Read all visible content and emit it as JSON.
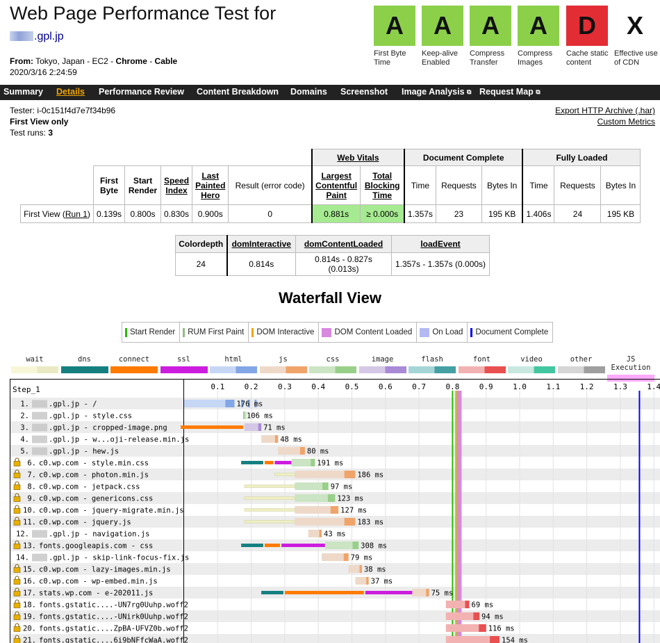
{
  "header": {
    "title": "Web Page Performance Test for",
    "site": ".gpl.jp",
    "from_label": "From:",
    "from_location": "Tokyo, Japan - EC2 -",
    "browser": "Chrome",
    "connectivity": "Cable",
    "date": "2020/3/16 2:24:59"
  },
  "grades": [
    {
      "grade": "A",
      "caption": "First Byte Time"
    },
    {
      "grade": "A",
      "caption": "Keep-alive Enabled"
    },
    {
      "grade": "A",
      "caption": "Compress Transfer"
    },
    {
      "grade": "A",
      "caption": "Compress Images"
    },
    {
      "grade": "D",
      "caption": "Cache static content"
    },
    {
      "grade": "X",
      "caption": "Effective use of CDN"
    }
  ],
  "nav": [
    "Summary",
    "Details",
    "Performance Review",
    "Content Breakdown",
    "Domains",
    "Screenshot",
    "Image Analysis",
    "Request Map"
  ],
  "nav_ext_icon": "external-link-icon",
  "test_info": {
    "tester": "Tester: i-0c151f4d7e7f34b96",
    "view": "First View only",
    "runs_label": "Test runs:",
    "runs": "3",
    "export_link": "Export HTTP Archive (.har)",
    "metrics_link": "Custom Metrics"
  },
  "results": {
    "group_web_vitals": "Web Vitals",
    "group_doc": "Document Complete",
    "group_full": "Fully Loaded",
    "h_first_byte": "First Byte",
    "h_start_render": "Start Render",
    "h_speed_index": "Speed Index",
    "h_last_painted": "Last Painted Hero",
    "h_result": "Result (error code)",
    "h_lcp": "Largest Contentful Paint",
    "h_tbt": "Total Blocking Time",
    "h_time": "Time",
    "h_requests": "Requests",
    "h_bytes": "Bytes In",
    "row_label": "First View (",
    "run_link": "Run 1",
    "row_label_end": ")",
    "first_byte": "0.139s",
    "start_render": "0.800s",
    "speed_index": "0.830s",
    "last_painted": "0.900s",
    "result": "0",
    "lcp": "0.881s",
    "tbt": "≥ 0.000s",
    "doc_time": "1.357s",
    "doc_requests": "23",
    "doc_bytes": "195 KB",
    "full_time": "1.406s",
    "full_requests": "24",
    "full_bytes": "195 KB"
  },
  "dom_table": {
    "h_colordepth": "Colordepth",
    "h_interactive": "domInteractive",
    "h_content_loaded": "domContentLoaded",
    "h_load_event": "loadEvent",
    "colordepth": "24",
    "interactive": "0.814s",
    "content_loaded": "0.814s - 0.827s (0.013s)",
    "load_event": "1.357s - 1.357s (0.000s)"
  },
  "waterfall": {
    "title": "Waterfall View",
    "markers": [
      {
        "label": "Start Render",
        "color": "#28bc00",
        "kind": "line"
      },
      {
        "label": "RUM First Paint",
        "color": "#8fbc83",
        "kind": "line"
      },
      {
        "label": "DOM Interactive",
        "color": "#f0a500",
        "kind": "line"
      },
      {
        "label": "DOM Content Loaded",
        "color": "#d888df",
        "kind": "box"
      },
      {
        "label": "On Load",
        "color": "#b3b9f2",
        "kind": "box"
      },
      {
        "label": "Document Complete",
        "color": "#0000ff",
        "kind": "line"
      }
    ],
    "types": [
      {
        "label": "wait",
        "a": "#f7f7d8",
        "b": "#e9e9c4"
      },
      {
        "label": "dns",
        "a": "#168080",
        "b": "#168080"
      },
      {
        "label": "connect",
        "a": "#ff7b00",
        "b": "#ff7b00"
      },
      {
        "label": "ssl",
        "a": "#cc1dde",
        "b": "#cc1dde"
      },
      {
        "label": "html",
        "a": "#c6d7f6",
        "b": "#82a6e6"
      },
      {
        "label": "js",
        "a": "#eed9c9",
        "b": "#f0a46a"
      },
      {
        "label": "css",
        "a": "#cbe4c4",
        "b": "#99d089"
      },
      {
        "label": "image",
        "a": "#d5c8e6",
        "b": "#a98ad6"
      },
      {
        "label": "flash",
        "a": "#a6d5d7",
        "b": "#44a0a3"
      },
      {
        "label": "font",
        "a": "#f3b2b2",
        "b": "#e95050"
      },
      {
        "label": "video",
        "a": "#c8e8df",
        "b": "#43c7a0"
      },
      {
        "label": "other",
        "a": "#d6d6d6",
        "b": "#9f9f9f"
      },
      {
        "label": "JS Execution",
        "a": "#ffaaff",
        "b": "#ffaaff"
      }
    ],
    "step_label": "Step_1",
    "ticks": [
      "0.1",
      "0.2",
      "0.3",
      "0.4",
      "0.5",
      "0.6",
      "0.7",
      "0.8",
      "0.9",
      "1.0",
      "1.1",
      "1.2",
      "1.3",
      "1.4"
    ],
    "lock_icon": "lock-icon",
    "requests": [
      {
        "n": "1.",
        "label": ".gpl.jp - /",
        "secure": false,
        "blur": true,
        "type": "html",
        "wait": 0.0,
        "dns": 0.0,
        "connect": 0.04,
        "ssl": 0.0,
        "start": 0.0,
        "ttfb": 0.08,
        "dl": 0.15,
        "ms": "176 ms"
      },
      {
        "n": "2.",
        "label": ".gpl.jp - style.css",
        "secure": false,
        "blur": true,
        "type": "css",
        "wait": 0.0,
        "dns": 0.0,
        "connect": 0.0,
        "ssl": 0.0,
        "start": 0.18,
        "ttfb": 0.0,
        "dl": 0.18,
        "ms": "106 ms"
      },
      {
        "n": "3.",
        "label": ".gpl.jp - cropped-image.png",
        "secure": false,
        "blur": true,
        "type": "image",
        "wait": 0.0,
        "dns": 0.0,
        "connect": 0.03,
        "ssl": 0.0,
        "start": 0.18,
        "ttfb": 0.0,
        "dl": 0.23,
        "ms": "71 ms"
      },
      {
        "n": "4.",
        "label": ".gpl.jp - w...oji-release.min.js",
        "secure": false,
        "blur": true,
        "type": "js",
        "wait": 0.0,
        "dns": 0.0,
        "connect": 0.0,
        "ssl": 0.0,
        "start": 0.23,
        "ttfb": 0.0,
        "dl": 0.28,
        "ms": "48 ms"
      },
      {
        "n": "5.",
        "label": ".gpl.jp - hew.js",
        "secure": false,
        "blur": true,
        "type": "js",
        "wait": 0.0,
        "dns": 0.0,
        "connect": 0.0,
        "ssl": 0.0,
        "start": 0.28,
        "ttfb": 0.0,
        "dl": 0.36,
        "ms": "80 ms"
      },
      {
        "n": "6.",
        "label": "c0.wp.com - style.min.css",
        "secure": true,
        "blur": false,
        "type": "css",
        "wait": 0.0,
        "dns": 0.17,
        "connect": 0.24,
        "ssl": 0.27,
        "start": 0.32,
        "ttfb": 0.0,
        "dl": 0.39,
        "ms": "191 ms"
      },
      {
        "n": "7.",
        "label": "c0.wp.com - photon.min.js",
        "secure": true,
        "blur": false,
        "type": "js",
        "wait": 0.27,
        "dns": 0.0,
        "connect": 0.0,
        "ssl": 0.0,
        "start": 0.33,
        "ttfb": 0.0,
        "dl": 0.51,
        "ms": "186 ms"
      },
      {
        "n": "8.",
        "label": "c0.wp.com - jetpack.css",
        "secure": true,
        "blur": false,
        "type": "css",
        "wait": 0.18,
        "dns": 0.0,
        "connect": 0.0,
        "ssl": 0.0,
        "start": 0.33,
        "ttfb": 0.0,
        "dl": 0.43,
        "ms": "97 ms"
      },
      {
        "n": "9.",
        "label": "c0.wp.com - genericons.css",
        "secure": true,
        "blur": false,
        "type": "css",
        "wait": 0.18,
        "dns": 0.0,
        "connect": 0.0,
        "ssl": 0.0,
        "start": 0.33,
        "ttfb": 0.0,
        "dl": 0.45,
        "ms": "123 ms"
      },
      {
        "n": "10.",
        "label": "c0.wp.com - jquery-migrate.min.js",
        "secure": true,
        "blur": false,
        "type": "js",
        "wait": 0.18,
        "dns": 0.0,
        "connect": 0.0,
        "ssl": 0.0,
        "start": 0.33,
        "ttfb": 0.0,
        "dl": 0.46,
        "ms": "127 ms"
      },
      {
        "n": "11.",
        "label": "c0.wp.com - jquery.js",
        "secure": true,
        "blur": false,
        "type": "js",
        "wait": 0.18,
        "dns": 0.0,
        "connect": 0.0,
        "ssl": 0.0,
        "start": 0.33,
        "ttfb": 0.0,
        "dl": 0.51,
        "ms": "183 ms"
      },
      {
        "n": "12.",
        "label": ".gpl.jp - navigation.js",
        "secure": false,
        "blur": true,
        "type": "js",
        "wait": 0.0,
        "dns": 0.0,
        "connect": 0.0,
        "ssl": 0.0,
        "start": 0.37,
        "ttfb": 0.0,
        "dl": 0.41,
        "ms": "43 ms"
      },
      {
        "n": "13.",
        "label": "fonts.googleapis.com - css",
        "secure": true,
        "blur": false,
        "type": "css",
        "wait": 0.0,
        "dns": 0.17,
        "connect": 0.24,
        "ssl": 0.29,
        "start": 0.42,
        "ttfb": 0.0,
        "dl": 0.52,
        "ms": "308 ms"
      },
      {
        "n": "14.",
        "label": ".gpl.jp - skip-link-focus-fix.js",
        "secure": false,
        "blur": true,
        "type": "js",
        "wait": 0.0,
        "dns": 0.0,
        "connect": 0.0,
        "ssl": 0.0,
        "start": 0.41,
        "ttfb": 0.0,
        "dl": 0.49,
        "ms": "79 ms"
      },
      {
        "n": "15.",
        "label": "c0.wp.com - lazy-images.min.js",
        "secure": true,
        "blur": false,
        "type": "js",
        "wait": 0.0,
        "dns": 0.0,
        "connect": 0.0,
        "ssl": 0.0,
        "start": 0.49,
        "ttfb": 0.0,
        "dl": 0.53,
        "ms": "38 ms"
      },
      {
        "n": "16.",
        "label": "c0.wp.com - wp-embed.min.js",
        "secure": true,
        "blur": false,
        "type": "js",
        "wait": 0.0,
        "dns": 0.0,
        "connect": 0.0,
        "ssl": 0.0,
        "start": 0.51,
        "ttfb": 0.0,
        "dl": 0.55,
        "ms": "37 ms"
      },
      {
        "n": "17.",
        "label": "stats.wp.com - e-202011.js",
        "secure": true,
        "blur": false,
        "type": "js",
        "wait": 0.0,
        "dns": 0.23,
        "connect": 0.3,
        "ssl": 0.54,
        "start": 0.68,
        "ttfb": 0.0,
        "dl": 0.73,
        "ms": "75 ms"
      },
      {
        "n": "18.",
        "label": "fonts.gstatic....-UN7rg0Uuhp.woff2",
        "secure": true,
        "blur": false,
        "type": "font",
        "wait": 0.0,
        "dns": 0.0,
        "connect": 0.0,
        "ssl": 0.0,
        "start": 0.78,
        "ttfb": 0.0,
        "dl": 0.85,
        "ms": "69 ms"
      },
      {
        "n": "19.",
        "label": "fonts.gstatic....-UNirk0Uuhp.woff2",
        "secure": true,
        "blur": false,
        "type": "font",
        "wait": 0.0,
        "dns": 0.0,
        "connect": 0.0,
        "ssl": 0.0,
        "start": 0.78,
        "ttfb": 0.0,
        "dl": 0.88,
        "ms": "94 ms"
      },
      {
        "n": "20.",
        "label": "fonts.gstatic....ZpBA-UFVZ0b.woff2",
        "secure": true,
        "blur": false,
        "type": "font",
        "wait": 0.0,
        "dns": 0.0,
        "connect": 0.0,
        "ssl": 0.0,
        "start": 0.78,
        "ttfb": 0.0,
        "dl": 0.9,
        "ms": "116 ms"
      },
      {
        "n": "21.",
        "label": "fonts.gstatic....6i9bNFfcWaA.woff2",
        "secure": true,
        "blur": false,
        "type": "font",
        "wait": 0.0,
        "dns": 0.0,
        "connect": 0.0,
        "ssl": 0.0,
        "start": 0.78,
        "ttfb": 0.0,
        "dl": 0.94,
        "ms": "154 ms"
      }
    ],
    "events": {
      "start_render": 0.8,
      "rum_first_paint": 0.81,
      "dom_interactive": 0.814,
      "dom_content_loaded": [
        0.814,
        0.827
      ],
      "document_complete": 1.357
    }
  }
}
